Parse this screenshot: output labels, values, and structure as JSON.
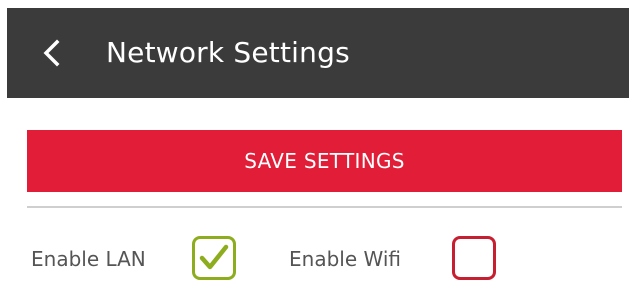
{
  "header": {
    "back_icon": "chevron-left-icon",
    "title": "Network Settings",
    "background_color": "#3b3b3b"
  },
  "actions": {
    "save_label": "SAVE SETTINGS",
    "save_color": "#e11d37"
  },
  "options": [
    {
      "label": "Enable LAN",
      "checked": true,
      "border_color": "#8dad1f"
    },
    {
      "label": "Enable Wifi",
      "checked": false,
      "border_color": "#c71f32"
    }
  ]
}
